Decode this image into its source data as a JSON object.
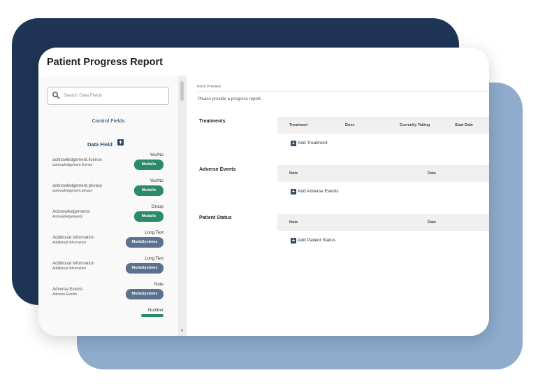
{
  "report": {
    "title": "Patient Progress Report"
  },
  "sidebar": {
    "search_placeholder": "Search Data Fields",
    "control_fields_label": "Control Fields",
    "data_field_label": "Data Field",
    "fields": [
      {
        "name": "acknowledgement.license",
        "sub": "acknowledgement.license",
        "type": "Yes/No",
        "badge": "Medallo",
        "badge_color": "#2a8a69"
      },
      {
        "name": "acknowledgement.privacy",
        "sub": "acknowledgement.privacy",
        "type": "Yes/No",
        "badge": "Medallo",
        "badge_color": "#2a8a69"
      },
      {
        "name": "Acknowledgements",
        "sub": "Acknowledgements",
        "type": "Group",
        "badge": "Medallo",
        "badge_color": "#2a8a69"
      },
      {
        "name": "Additional Information",
        "sub": "Additional Information",
        "type": "Long Text",
        "badge": "ModaSystems",
        "badge_color": "#5a7190"
      },
      {
        "name": "Additional Information",
        "sub": "Additional Information",
        "type": "Long Text",
        "badge": "ModaSystems",
        "badge_color": "#5a7190"
      },
      {
        "name": "Adverse Events",
        "sub": "Adverse Events",
        "type": "Note",
        "badge": "ModaSystems",
        "badge_color": "#5a7190"
      },
      {
        "name": "",
        "sub": "",
        "type": "Number",
        "badge": "",
        "badge_color": "#2a8a69"
      }
    ]
  },
  "form": {
    "preview_label": "Form Preview",
    "prompt": "Please provide a progress report.",
    "sections": [
      {
        "label": "Treatments",
        "columns": [
          "Treatment",
          "Dose",
          "Currently Taking",
          "Start Date"
        ],
        "add_label": "Add Treatment"
      },
      {
        "label": "Adverse Events",
        "columns": [
          "Note",
          "Date"
        ],
        "add_label": "Add Adverse Events"
      },
      {
        "label": "Patient Status",
        "columns": [
          "Note",
          "Date"
        ],
        "add_label": "Add Patient Status"
      }
    ]
  },
  "colors": {
    "navy_backdrop": "#1f3556",
    "light_backdrop": "#8faccd",
    "green_badge": "#2a8a69",
    "slate_badge": "#5a7190",
    "accent": "#2d4a69"
  }
}
